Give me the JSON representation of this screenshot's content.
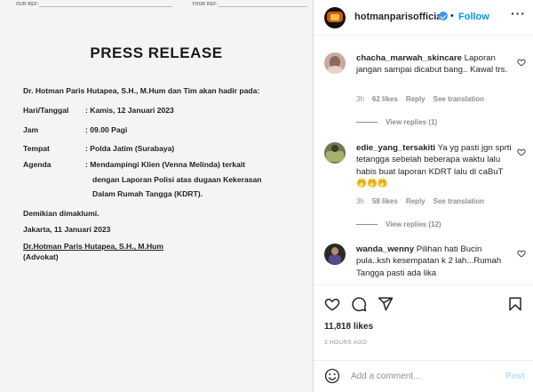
{
  "document": {
    "ref_left": "OUR REF:",
    "ref_right": "YOUR REF:",
    "heading": "PRESS RELEASE",
    "intro": "Dr. Hotman Paris Hutapea, S.H., M.Hum dan Tim akan hadir pada:",
    "rows": [
      {
        "label": "Hari/Tanggal",
        "value": ":   Kamis, 12 Januari 2023"
      },
      {
        "label": "Jam",
        "value": ":   09.00 Pagi"
      },
      {
        "label": "Tempat",
        "value": ":   Polda Jatim (Surabaya)"
      },
      {
        "label": "Agenda",
        "value": ":  Mendampingi Klien (Venna Melinda) terkait"
      }
    ],
    "agenda_cont": [
      "dengan Laporan Polisi atas dugaan Kekerasan",
      "Dalam Rumah Tangga (KDRT)."
    ],
    "closing": "Demikian dimaklumi.",
    "place_date": "Jakarta, 11 Januari 2023",
    "signatory": "Dr.Hotman Paris Hutapea, S.H., M.Hum",
    "signatory_title": "(Advokat)"
  },
  "post": {
    "username": "hotmanparisofficial",
    "follow_label": "Follow",
    "dot": "•",
    "more": "···"
  },
  "comments": [
    {
      "user": "chacha_marwah_skincare",
      "text": "Laporan jangan sampai dicabut bang.. Kawal trs.",
      "time": "3h",
      "likes": "62 likes",
      "reply": "Reply",
      "see_translation": "See translation",
      "view_replies": "View replies (1)"
    },
    {
      "user": "edie_yang_tersakiti",
      "text": "Ya yg pasti jgn sprti tetangga sebelah beberapa waktu lalu habis buat laporan KDRT lalu di caBuT 🤭🤭🤭",
      "time": "3h",
      "likes": "58 likes",
      "reply": "Reply",
      "see_translation": "See translation",
      "view_replies": "View replies (12)"
    },
    {
      "user": "wanda_wenny",
      "text": "Pilihan hati Bucin pula..ksh kesempatan k 2 lah...Rumah Tangga pasti ada lika"
    }
  ],
  "actions": {
    "icons": [
      "heart-icon",
      "comment-icon",
      "share-icon",
      "bookmark-icon"
    ],
    "likes": "11,818 likes",
    "time_ago": "3 HOURS AGO",
    "add_comment_placeholder": "Add a comment...",
    "post_label": "Post"
  },
  "colors": {
    "accent": "#0095f6",
    "verified": "#3897f0",
    "muted": "#8e8e8e",
    "post_disabled": "#b2dffc"
  }
}
